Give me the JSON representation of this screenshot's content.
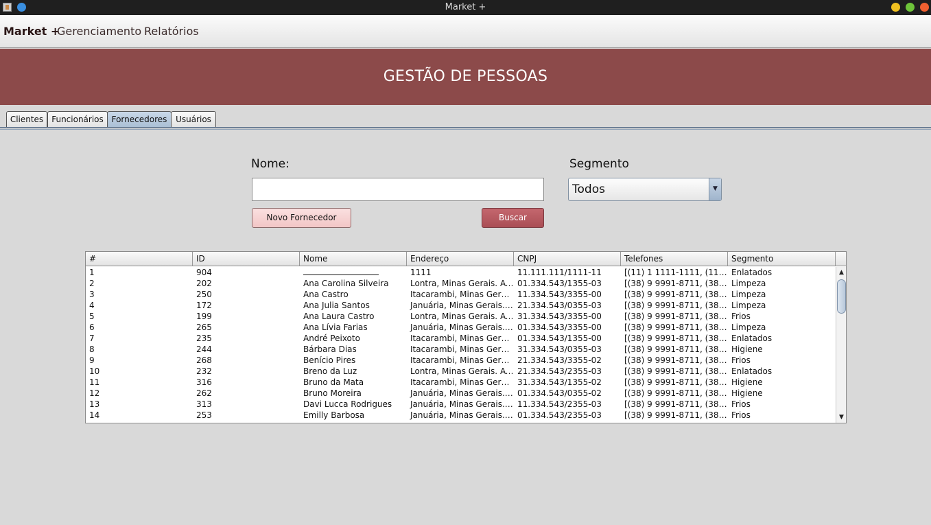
{
  "window": {
    "title": "Market +"
  },
  "menu": {
    "brand": "Market +",
    "items": [
      "Gerenciamento",
      "Relatórios"
    ]
  },
  "banner": {
    "title": "GESTÃO DE PESSOAS"
  },
  "tabs": [
    {
      "label": "Clientes",
      "active": false
    },
    {
      "label": "Funcionários",
      "active": false
    },
    {
      "label": "Fornecedores",
      "active": true
    },
    {
      "label": "Usuários",
      "active": false
    }
  ],
  "form": {
    "nome_label": "Nome:",
    "nome_value": "",
    "segmento_label": "Segmento",
    "segmento_value": "Todos",
    "novo_button": "Novo Fornecedor",
    "buscar_button": "Buscar"
  },
  "table": {
    "columns": [
      "#",
      "ID",
      "Nome",
      "Endereço",
      "CNPJ",
      "Telefones",
      "Segmento"
    ],
    "rows": [
      [
        "1",
        "904",
        "",
        "1111",
        "11.111.111/1111-11",
        "[(11) 1 1111-1111, (11) 1...",
        "Enlatados"
      ],
      [
        "2",
        "202",
        "Ana Carolina Silveira",
        "Lontra, Minas Gerais. Av...",
        "01.334.543/1355-03",
        "[(38) 9 9991-8711, (38) 9...",
        "Limpeza"
      ],
      [
        "3",
        "250",
        "Ana Castro",
        "Itacarambi, Minas Gerai...",
        "11.334.543/3355-00",
        "[(38) 9 9991-8711, (38) 9...",
        "Limpeza"
      ],
      [
        "4",
        "172",
        "Ana Julia Santos",
        "Januária, Minas Gerais. ...",
        "21.334.543/0355-03",
        "[(38) 9 9991-8711, (38) 9...",
        "Limpeza"
      ],
      [
        "5",
        "199",
        "Ana Laura Castro",
        "Lontra, Minas Gerais. Av...",
        "31.334.543/3355-00",
        "[(38) 9 9991-8711, (38) 9...",
        "Frios"
      ],
      [
        "6",
        "265",
        "Ana Lívia Farias",
        "Januária, Minas Gerais. ...",
        "01.334.543/3355-00",
        "[(38) 9 9991-8711, (38) 9...",
        "Limpeza"
      ],
      [
        "7",
        "235",
        "André Peixoto",
        "Itacarambi, Minas Gerai...",
        "01.334.543/1355-00",
        "[(38) 9 9991-8711, (38) 9...",
        "Enlatados"
      ],
      [
        "8",
        "244",
        "Bárbara Dias",
        "Itacarambi, Minas Gerai...",
        "31.334.543/0355-03",
        "[(38) 9 9991-8711, (38) 9...",
        "Higiene"
      ],
      [
        "9",
        "268",
        "Benício Pires",
        "Itacarambi, Minas Gerai...",
        "21.334.543/3355-02",
        "[(38) 9 9991-8711, (38) 9...",
        "Frios"
      ],
      [
        "10",
        "232",
        "Breno da Luz",
        "Lontra, Minas Gerais. Av...",
        "21.334.543/2355-03",
        "[(38) 9 9991-8711, (38) 9...",
        "Enlatados"
      ],
      [
        "11",
        "316",
        "Bruno da Mata",
        "Itacarambi, Minas Gerai...",
        "31.334.543/1355-02",
        "[(38) 9 9991-8711, (38) 9...",
        "Higiene"
      ],
      [
        "12",
        "262",
        "Bruno Moreira",
        "Januária, Minas Gerais. ...",
        "01.334.543/0355-02",
        "[(38) 9 9991-8711, (38) 9...",
        "Higiene"
      ],
      [
        "13",
        "313",
        "Davi Lucca Rodrigues",
        "Januária, Minas Gerais. ...",
        "11.334.543/2355-03",
        "[(38) 9 9991-8711, (38) 9...",
        "Frios"
      ],
      [
        "14",
        "253",
        "Emilly Barbosa",
        "Januária, Minas Gerais. ...",
        "01.334.543/2355-03",
        "[(38) 9 9991-8711, (38) 9...",
        "Frios"
      ]
    ]
  },
  "icons": {
    "scroll_up": "▲",
    "scroll_down": "▼",
    "dropdown": "▼"
  },
  "colors": {
    "banner": "#8c4a4a",
    "buscar_button": "#b2565d",
    "novo_button": "#f5d0d0",
    "active_tab": "#b8cadd"
  }
}
